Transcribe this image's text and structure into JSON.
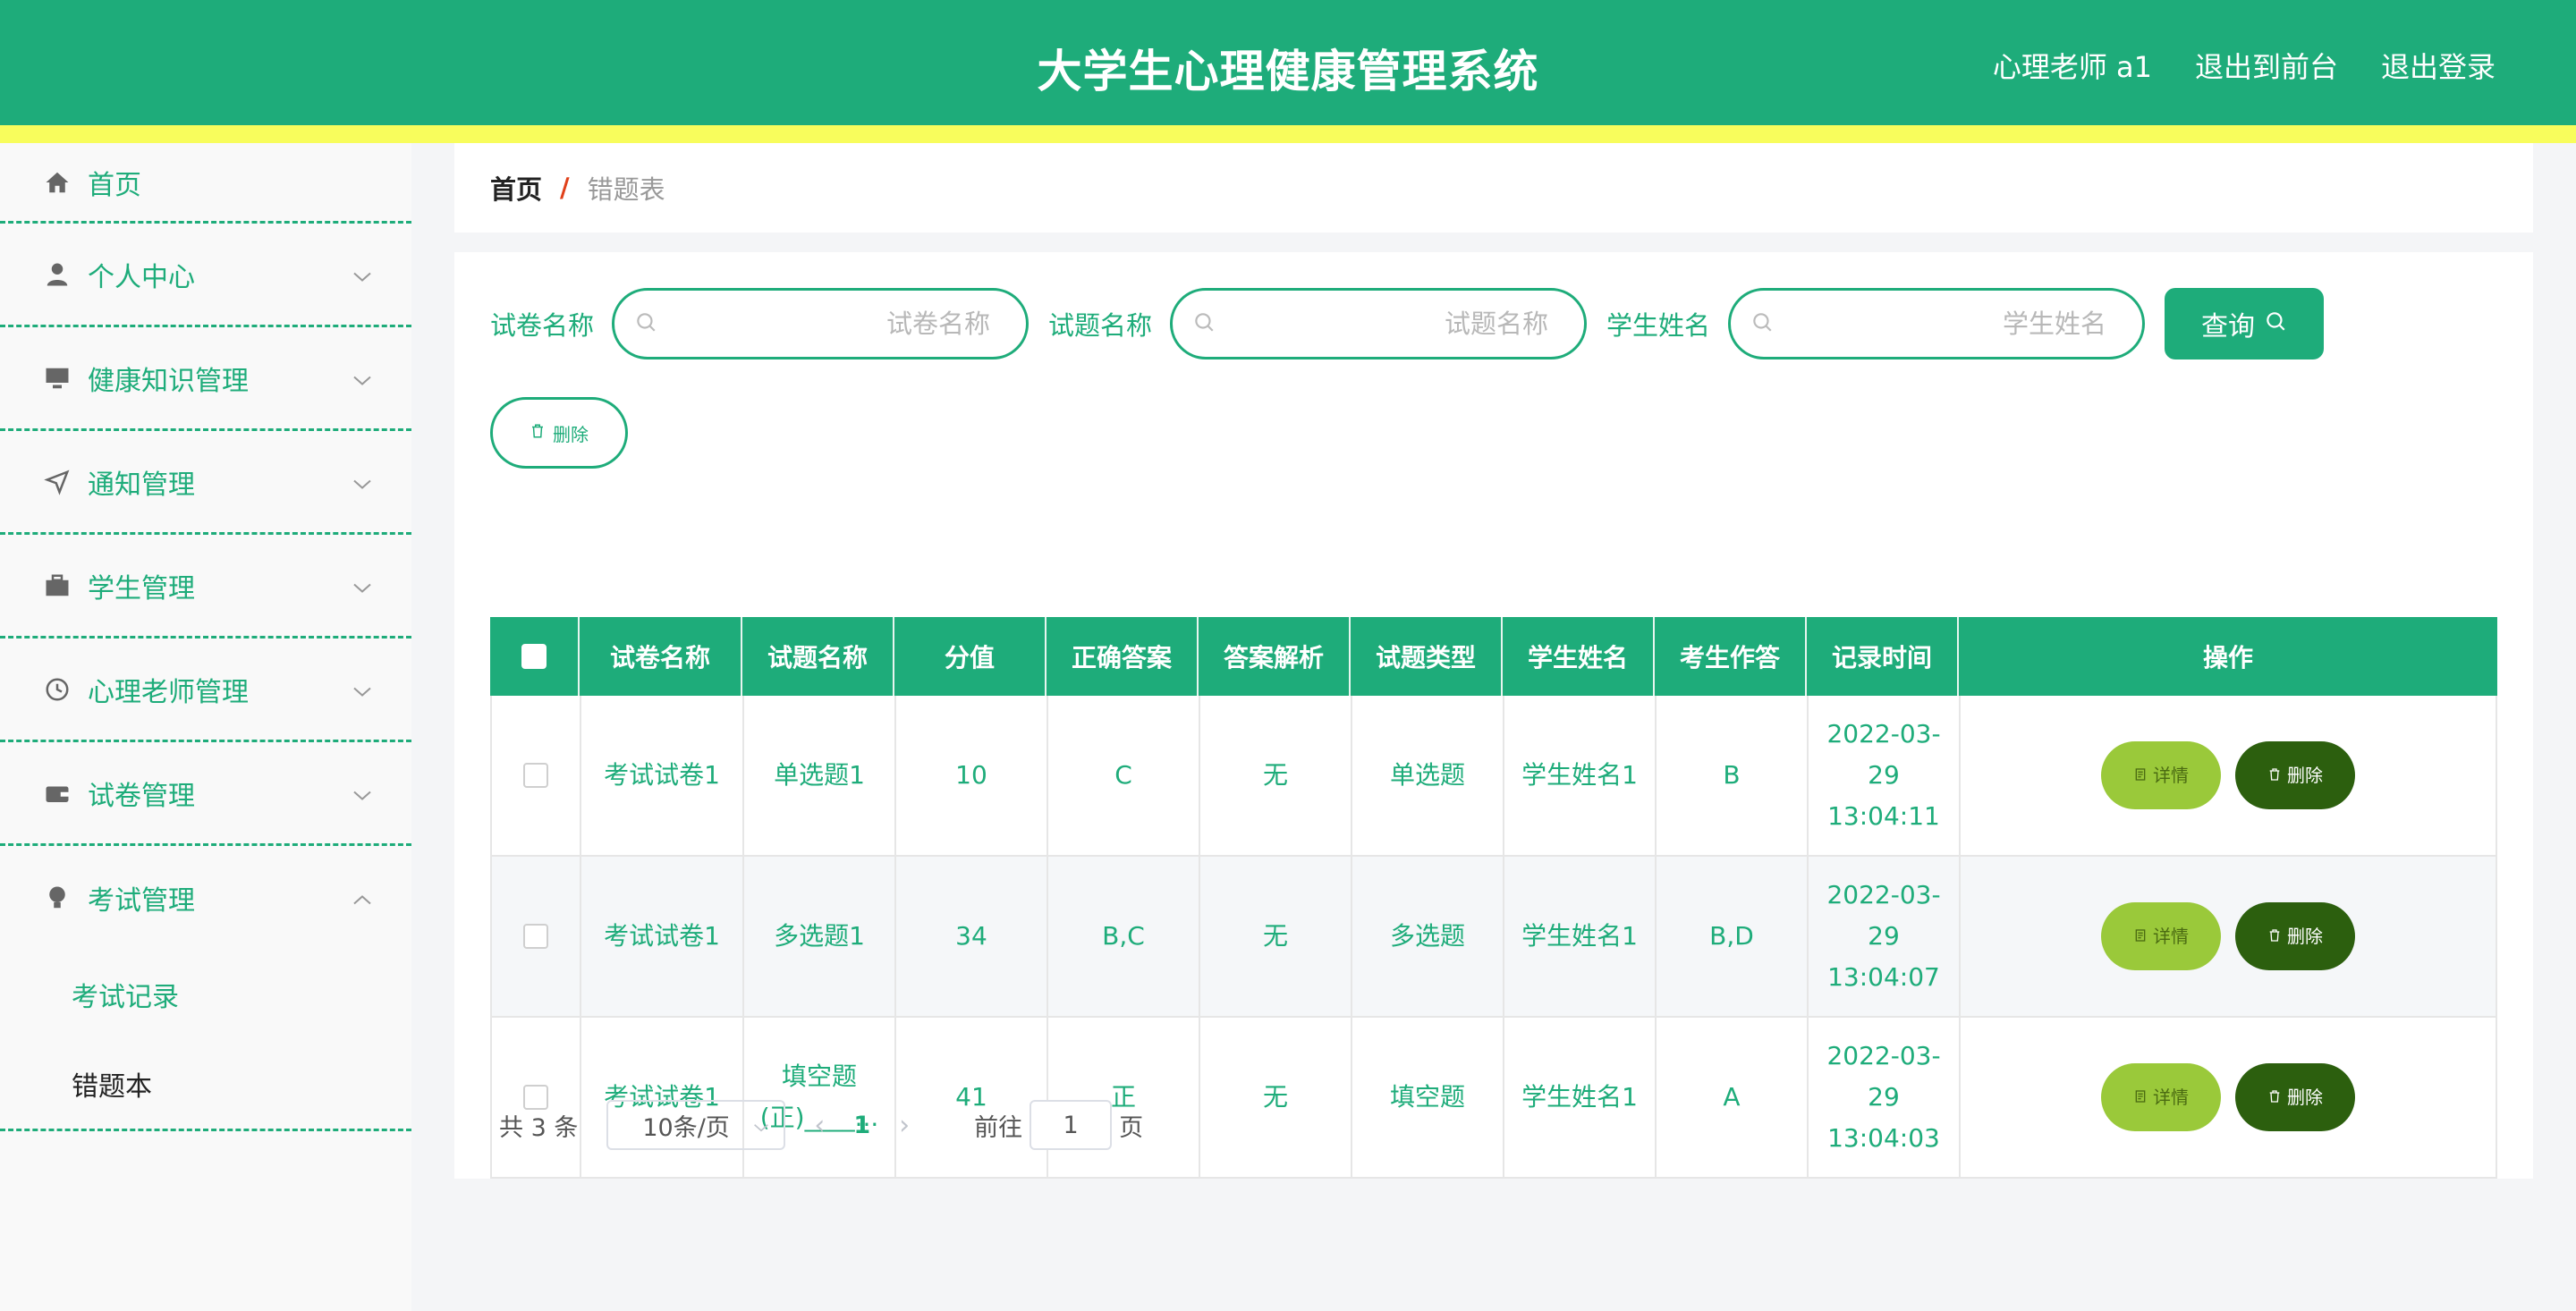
{
  "header": {
    "title": "大学生心理健康管理系统",
    "user_label": "心理老师 a1",
    "front_link": "退出到前台",
    "logout_link": "退出登录"
  },
  "sidebar": {
    "items": [
      {
        "label": "首页",
        "icon": "home-icon"
      },
      {
        "label": "个人中心",
        "icon": "user-icon"
      },
      {
        "label": "健康知识管理",
        "icon": "monitor-icon"
      },
      {
        "label": "通知管理",
        "icon": "send-icon"
      },
      {
        "label": "学生管理",
        "icon": "briefcase-icon"
      },
      {
        "label": "心理老师管理",
        "icon": "clock-icon"
      },
      {
        "label": "试卷管理",
        "icon": "wallet-icon"
      },
      {
        "label": "考试管理",
        "icon": "bulb-icon"
      }
    ],
    "submenu": [
      {
        "label": "考试记录"
      },
      {
        "label": "错题本"
      }
    ]
  },
  "breadcrumb": {
    "home": "首页",
    "separator": "/",
    "current": "错题表"
  },
  "search": {
    "paper_label": "试卷名称",
    "paper_placeholder": "试卷名称",
    "question_label": "试题名称",
    "question_placeholder": "试题名称",
    "student_label": "学生姓名",
    "student_placeholder": "学生姓名",
    "query_button": "查询"
  },
  "toolbar": {
    "delete_label": "删除"
  },
  "table": {
    "headers": [
      "试卷名称",
      "试题名称",
      "分值",
      "正确答案",
      "答案解析",
      "试题类型",
      "学生姓名",
      "考生作答",
      "记录时间",
      "操作"
    ],
    "rows": [
      {
        "paper": "考试试卷1",
        "question": "单选题1",
        "score": "10",
        "answer": "C",
        "analysis": "无",
        "type": "单选题",
        "student": "学生姓名1",
        "response": "B",
        "time": "2022-03-29 13:04:11"
      },
      {
        "paper": "考试试卷1",
        "question": "多选题1",
        "score": "34",
        "answer": "B,C",
        "analysis": "无",
        "type": "多选题",
        "student": "学生姓名1",
        "response": "B,D",
        "time": "2022-03-29 13:04:07"
      },
      {
        "paper": "考试试卷1",
        "question": "填空题(正)____...",
        "score": "41",
        "answer": "正",
        "analysis": "无",
        "type": "填空题",
        "student": "学生姓名1",
        "response": "A",
        "time": "2022-03-29 13:04:03"
      }
    ],
    "detail_label": "详情",
    "delete_label": "删除"
  },
  "pagination": {
    "total": "共 3 条",
    "page_size": "10条/页",
    "current_page": "1",
    "goto_label": "前往",
    "goto_value": "1",
    "page_suffix": "页"
  },
  "colors": {
    "primary": "#1eac7a",
    "stripe": "#f8fd5c",
    "detail_button": "#9ac93a",
    "delete_button": "#2c5f0e"
  }
}
